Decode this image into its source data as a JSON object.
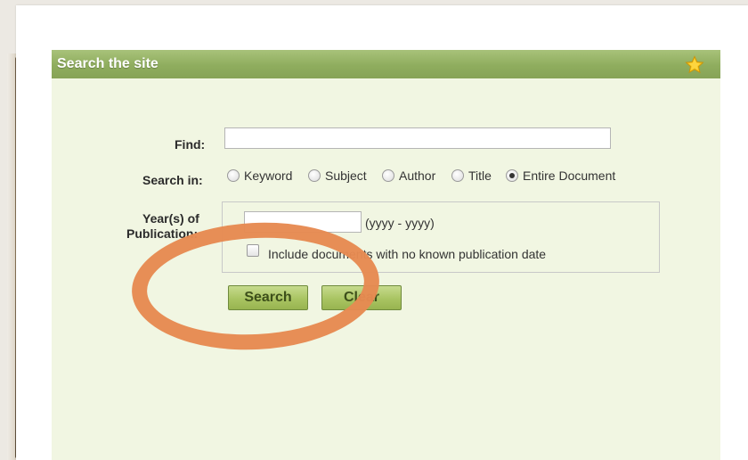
{
  "panel": {
    "title": "Search the site"
  },
  "form": {
    "find_label": "Find:",
    "find_value": "",
    "search_in_label": "Search in:",
    "search_in_options": [
      {
        "label": "Keyword",
        "checked": false
      },
      {
        "label": "Subject",
        "checked": false
      },
      {
        "label": "Author",
        "checked": false
      },
      {
        "label": "Title",
        "checked": false
      },
      {
        "label": "Entire Document",
        "checked": true
      }
    ],
    "year_label_line1": "Year(s) of",
    "year_label_line2": "Publication:",
    "year_value": "",
    "year_hint": "(yyyy - yyyy)",
    "include_no_date_label": "Include documents with no known publication date",
    "include_no_date_checked": false,
    "search_button": "Search",
    "clear_button": "Clear"
  },
  "colors": {
    "header_green": "#8fad5e",
    "panel_bg": "#f1f6e2",
    "button_green": "#a9c462",
    "annotation_orange": "#e68a52",
    "star_gold": "#f5c518"
  },
  "icons": {
    "header_icon": "star-icon"
  }
}
